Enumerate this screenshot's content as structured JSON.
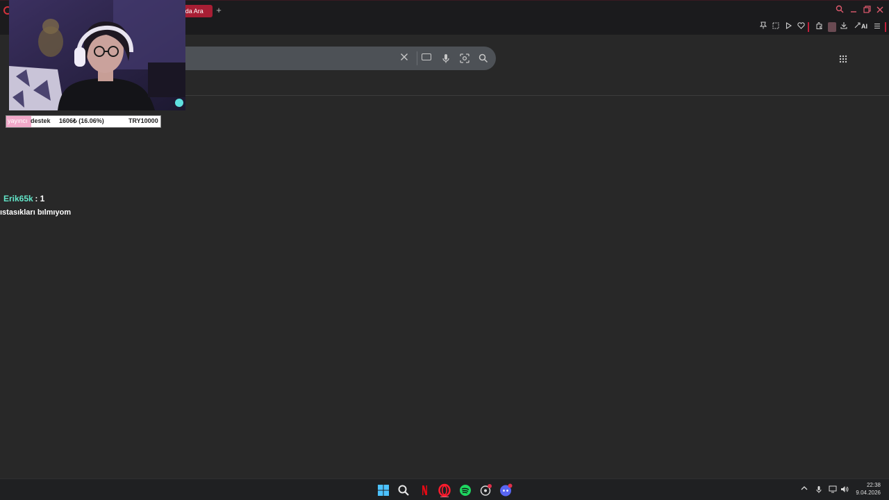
{
  "browser": {
    "active_tab_label": "'da Ara",
    "new_tab_label": "+",
    "toolbar_ai_label": "AI"
  },
  "icons": {
    "opera_logo": "opera-logo-icon",
    "new_tab": "plus-icon",
    "window_search": "search-icon",
    "minimize": "minimize-icon",
    "restore": "restore-icon",
    "close": "close-icon",
    "toolbar": [
      "pin-icon",
      "snapshot-icon",
      "play-icon",
      "heart-icon",
      "extensions-icon",
      "profile-icon",
      "download-icon",
      "aria-icon",
      "menu-icon"
    ],
    "search_bar": [
      "clear-icon",
      "keyboard-icon",
      "mic-icon",
      "lens-icon",
      "search-icon"
    ],
    "apps": "apps-grid-icon"
  },
  "overlay": {
    "goal": {
      "label_a": "yayıncı",
      "label_b": "destek",
      "progress_text": "1606₺ (16.06%)",
      "target_text": "TRY10000",
      "progress_fraction": 0.1606
    },
    "chat": {
      "username": "Erik65k",
      "separator": " : 1",
      "message": "ıstasıkları bılmıyom"
    }
  },
  "taskbar": {
    "apps": [
      "windows-start-icon",
      "search-icon",
      "netflix-icon",
      "opera-icon",
      "spotify-icon",
      "app-icon",
      "discord-icon"
    ],
    "tray": {
      "time": "22:38",
      "date": "9.04.2026"
    }
  },
  "colors": {
    "page_bg": "#282828",
    "chrome_bg": "#1b1b1d",
    "accent_red": "#c0203b",
    "search_bg": "#4d5156",
    "chat_user": "#63e6c9",
    "goal_fill": "#f2a9c9"
  }
}
